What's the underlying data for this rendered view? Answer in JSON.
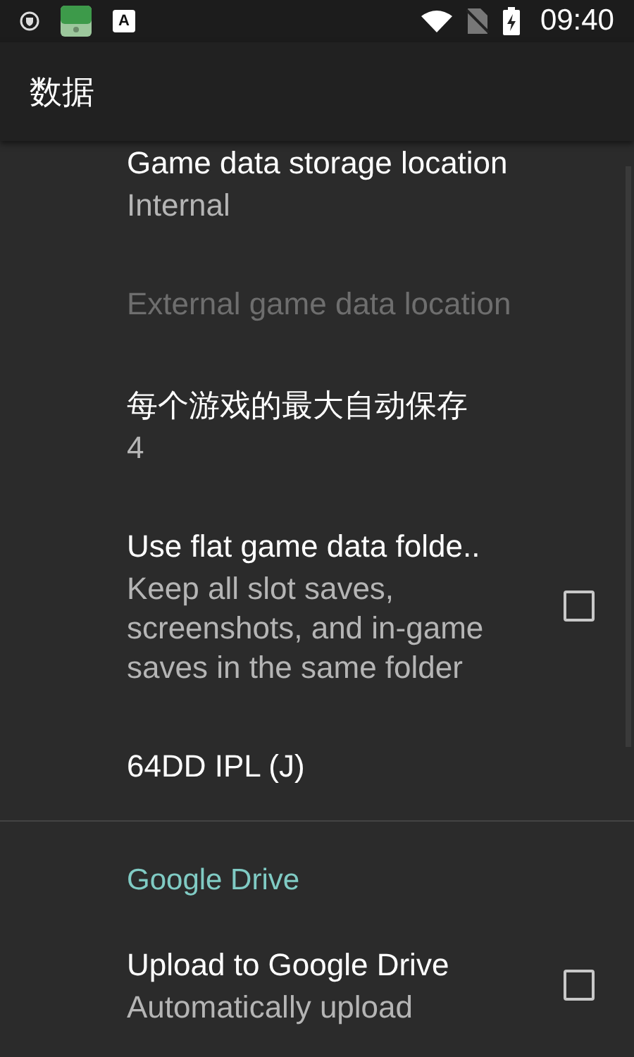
{
  "status_bar": {
    "app_badge_letter": "A",
    "time": "09:40"
  },
  "toolbar": {
    "title": "数据"
  },
  "items": [
    {
      "kind": "preference",
      "title": "Game data storage location",
      "summary": "Internal",
      "disabled": false
    },
    {
      "kind": "preference",
      "title": "External game data location",
      "disabled": true
    },
    {
      "kind": "preference",
      "title": "每个游戏的最大自动保存",
      "summary": "4",
      "disabled": false
    },
    {
      "kind": "checkbox",
      "title": "Use flat game data folde..",
      "summary": "Keep all slot saves, screenshots, and in-game saves in the same folder",
      "disabled": false,
      "checked": false
    },
    {
      "kind": "preference",
      "title": "64DD IPL (J)",
      "disabled": false
    },
    {
      "kind": "category",
      "title": "Google Drive"
    },
    {
      "kind": "checkbox",
      "title": "Upload to Google Drive",
      "summary": "Automatically upload",
      "disabled": false,
      "checked": false
    }
  ]
}
